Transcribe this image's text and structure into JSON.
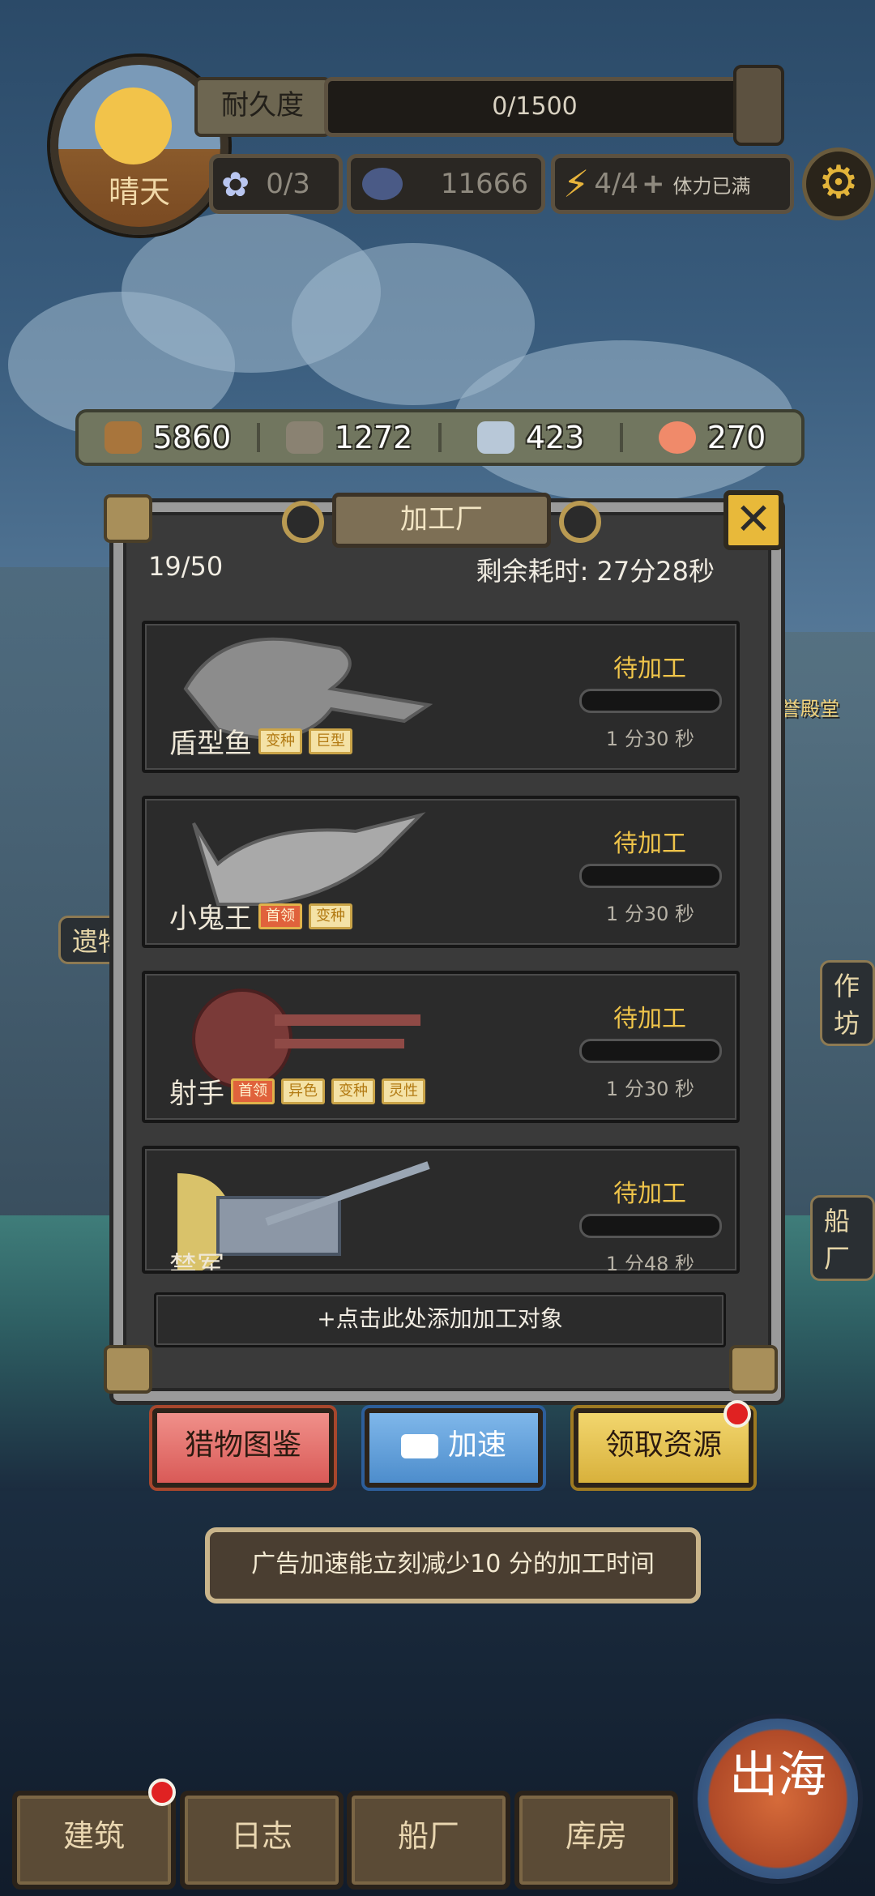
{
  "hud": {
    "weather": "晴天",
    "durability_label": "耐久度",
    "durability_value": "0/1500",
    "pearls": "0/3",
    "coins": "11666",
    "stamina": "4/4",
    "stamina_plus": "+",
    "stamina_status": "体力已满"
  },
  "resources": [
    {
      "icon": "wood-log-icon",
      "value": "5860",
      "color": "#a8753c"
    },
    {
      "icon": "stone-icon",
      "value": "1272",
      "color": "#8a8272"
    },
    {
      "icon": "metal-ingot-icon",
      "value": "423",
      "color": "#b8c8d8"
    },
    {
      "icon": "fish-steak-icon",
      "value": "270",
      "color": "#f08a6a"
    }
  ],
  "panel": {
    "title": "加工厂",
    "count": "19/50",
    "remaining": "剩余耗时: 27分28秒",
    "add_label": "+点击此处添加加工对象"
  },
  "items": [
    {
      "name": "盾型鱼",
      "tags": [
        {
          "text": "变种",
          "red": false
        },
        {
          "text": "巨型",
          "red": false
        }
      ],
      "status": "待加工",
      "time": "1 分30 秒",
      "progress": 0
    },
    {
      "name": "小鬼王",
      "tags": [
        {
          "text": "首领",
          "red": true
        },
        {
          "text": "变种",
          "red": false
        }
      ],
      "status": "待加工",
      "time": "1 分30 秒",
      "progress": 0
    },
    {
      "name": "射手",
      "tags": [
        {
          "text": "首领",
          "red": true
        },
        {
          "text": "异色",
          "red": false
        },
        {
          "text": "变种",
          "red": false
        },
        {
          "text": "灵性",
          "red": false
        }
      ],
      "status": "待加工",
      "time": "1 分30 秒",
      "progress": 0
    },
    {
      "name": "禁军",
      "tags": [],
      "status": "待加工",
      "time": "1 分48 秒",
      "progress": 0
    }
  ],
  "buttons": {
    "catalog": "猎物图鉴",
    "speedup": "加速",
    "collect": "领取资源"
  },
  "tip": "广告加速能立刻减少10 分的加工时间",
  "side": {
    "relics": "遗物",
    "workshop": "作坊",
    "shipyard": "船厂",
    "honor_hall": "荣誉殿堂"
  },
  "nav": [
    "建筑",
    "日志",
    "船厂",
    "库房"
  ],
  "sail": "出海"
}
